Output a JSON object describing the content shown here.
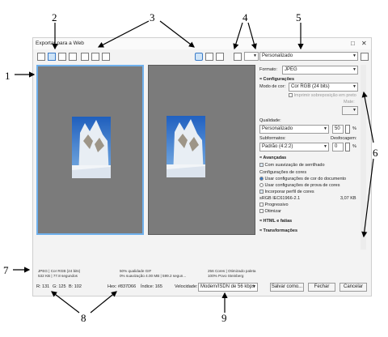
{
  "callouts": [
    "1",
    "2",
    "3",
    "4",
    "5",
    "6",
    "7",
    "8",
    "9"
  ],
  "dialog": {
    "title": "Exportar para a Web",
    "maximize": "□",
    "close": "✕"
  },
  "toolbar": {
    "preset_value": "Personalizado",
    "color_value": ""
  },
  "left_info": {
    "format": "JPEG  |  Cor RGB (24 bits)",
    "size": "532 KB  |  77.8 segundos",
    "quality": "50% qualidade  GIF",
    "smoothing": "0% suavização  4.00 MB  |  599.2 segun..."
  },
  "right_info": {
    "colors": "256 Cores  |  Otimizado paleta",
    "credit": "100% Povo Steinberg"
  },
  "panel": {
    "format_label": "Formato:",
    "format_value": "JPEG",
    "configs_header": "Configurações",
    "color_mode_label": "Modo de cor:",
    "color_mode_value": "Cor RGB (24 bits)",
    "overprint": "Imprimir sobreposição em preto",
    "matte_label": "Mate:",
    "quality_label": "Qualidade:",
    "quality_preset": "Personalizado",
    "quality_value": "50",
    "quality_unit": "%",
    "subformat_label": "Subformatos:",
    "blur_label": "Desfocagem:",
    "subformat_value": "Padrão (4:2:2)",
    "blur_value": "0",
    "blur_unit": "%",
    "advanced_header": "Avançadas",
    "antialias": "Com suavização de serrilhado",
    "color_settings_label": "Configurações de cores",
    "use_doc_color": "Usar configurações de cor do documento",
    "use_proof_color": "Usar configurações de prova de cores",
    "embed_profile": "Incorporar perfil de cores",
    "profile_name": "sRGB IEC61966-2.1",
    "profile_size": "3,07 KB",
    "progressive": "Progressivo",
    "optimize": "Otimizar",
    "html_header": "HTML e fatias",
    "transform_header": "Transformações"
  },
  "statusbar": {
    "r": "R: 131",
    "g": "G: 125",
    "b": "B: 102",
    "hex": "Hex: #837D66",
    "index": "Índice: 165",
    "speed_label": "Velocidade:",
    "speed_value": "Modem/ISDN de 56 kbps",
    "save_as": "Salvar como...",
    "close": "Fechar",
    "cancel": "Cancelar"
  }
}
